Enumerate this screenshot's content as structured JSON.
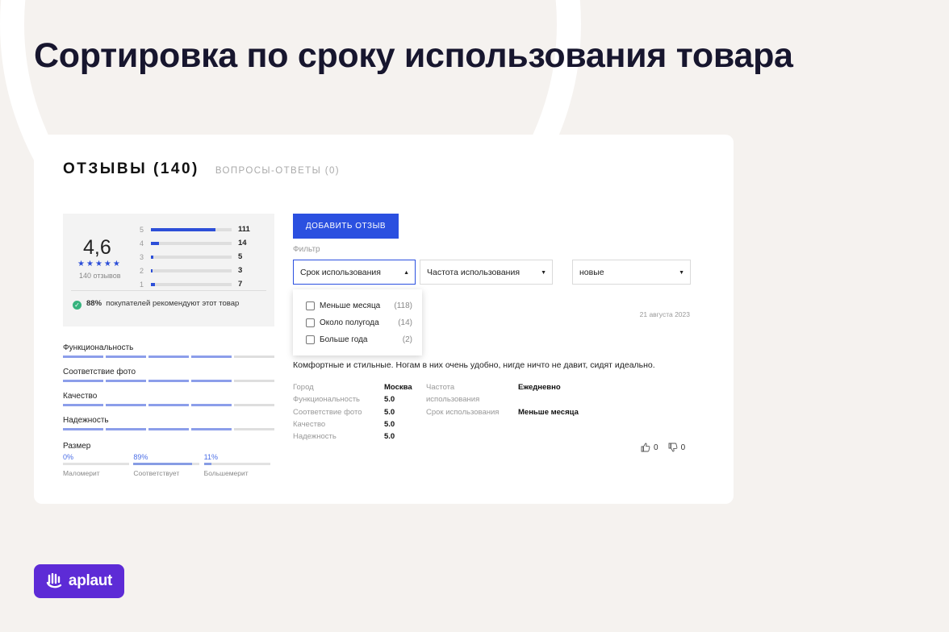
{
  "page": {
    "title": "Сортировка по сроку использования товара"
  },
  "tabs": {
    "reviews": "ОТЗЫВЫ (140)",
    "qa": "ВОПРОСЫ-ОТВЕТЫ (0)"
  },
  "summary": {
    "score": "4,6",
    "rating_stars": 4.5,
    "reviews_count": "140 отзывов",
    "distribution": [
      {
        "star": "5",
        "count": "111",
        "fraction": 0.8
      },
      {
        "star": "4",
        "count": "14",
        "fraction": 0.1
      },
      {
        "star": "3",
        "count": "5",
        "fraction": 0.03
      },
      {
        "star": "2",
        "count": "3",
        "fraction": 0.02
      },
      {
        "star": "1",
        "count": "7",
        "fraction": 0.05
      }
    ],
    "recommend_pct": "88%",
    "recommend_text": "покупателей рекомендуют этот товар"
  },
  "attributes": [
    {
      "label": "Функциональность",
      "level": 4
    },
    {
      "label": "Соответствие фото",
      "level": 4
    },
    {
      "label": "Качество",
      "level": 4
    },
    {
      "label": "Надежность",
      "level": 4
    }
  ],
  "size": {
    "label": "Размер",
    "options": [
      {
        "pct": "0%",
        "value": 0,
        "label": "Маломерит"
      },
      {
        "pct": "89%",
        "value": 0.89,
        "label": "Соответствует"
      },
      {
        "pct": "11%",
        "value": 0.11,
        "label": "Большемерит"
      }
    ]
  },
  "actions": {
    "add_review": "ДОБАВИТЬ ОТЗЫВ"
  },
  "filter": {
    "label": "Фильтр",
    "usage_period": "Срок использования",
    "usage_frequency": "Частота использования",
    "sort": "новые",
    "dropdown_options": [
      {
        "label": "Меньше месяца",
        "count": "(118)"
      },
      {
        "label": "Около полугода",
        "count": "(14)"
      },
      {
        "label": "Больше года",
        "count": "(2)"
      }
    ]
  },
  "review": {
    "date": "21 августа 2023",
    "text": "Комфортные и стильные. Ногам в них очень удобно, нигде ничто не давит, сидят идеально.",
    "details_left": [
      {
        "key": "Город",
        "value": "Москва"
      },
      {
        "key": "Функциональность",
        "value": "5.0"
      },
      {
        "key": "Соответствие фото",
        "value": "5.0"
      },
      {
        "key": "Качество",
        "value": "5.0"
      },
      {
        "key": "Надежность",
        "value": "5.0"
      }
    ],
    "frequency_key_line1": "Частота",
    "frequency_key_line2": "использования",
    "frequency_value": "Ежедневно",
    "period_key": "Срок использования",
    "period_value": "Меньше месяца",
    "likes": "0",
    "dislikes": "0"
  },
  "brand": {
    "logo_text": "aplaut",
    "color": "#5d2bd6"
  },
  "colors": {
    "accent": "#2b50e0",
    "background": "#f5f2ef"
  }
}
